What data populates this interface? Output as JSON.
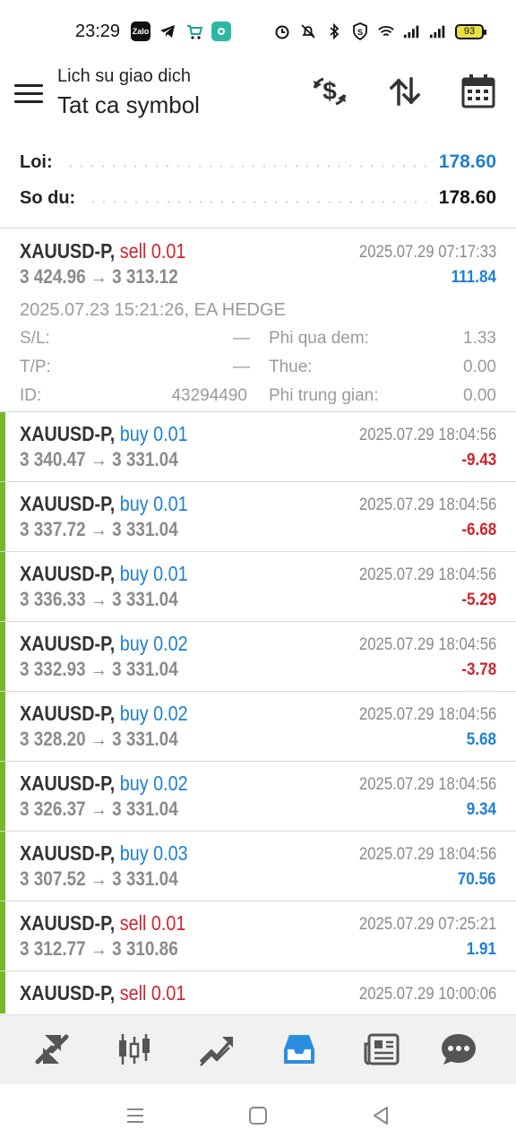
{
  "status_bar": {
    "time": "23:29",
    "battery": "93",
    "app_icons": [
      "zalo-icon",
      "telegram-icon",
      "shopping-icon",
      "maps-icon"
    ],
    "system_icons": [
      "alarm-icon",
      "mute-icon",
      "bluetooth-icon",
      "shield-icon",
      "wifi-icon",
      "signal-icon",
      "signal-icon"
    ]
  },
  "header": {
    "title": "Lich su giao dich",
    "subtitle": "Tat ca symbol",
    "actions": [
      "currency-exchange-icon",
      "sort-icon",
      "calendar-icon"
    ]
  },
  "summary": {
    "profit_label": "Loi:",
    "profit_value": "178.60",
    "balance_label": "So du:",
    "balance_value": "178.60"
  },
  "colors": {
    "buy": "#1e7fd4",
    "sell": "#d0242d",
    "profit_pos": "#1e7fd4",
    "profit_neg": "#d0242d",
    "accent_bar": "#76b82a",
    "active_nav": "#2a8ee0"
  },
  "trades": [
    {
      "symbol": "XAUUSD-P,",
      "type": "sell 0.01",
      "side": "sell",
      "date": "2025.07.29 07:17:33",
      "prices": "3 424.96 → 3 313.12",
      "profit": "111.84",
      "expanded": true,
      "details": {
        "comment": "2025.07.23 15:21:26, EA HEDGE",
        "sl_label": "S/L:",
        "sl_value": "—",
        "tp_label": "T/P:",
        "tp_value": "—",
        "id_label": "ID:",
        "id_value": "43294490",
        "swap_label": "Phi qua dem:",
        "swap_value": "1.33",
        "tax_label": "Thue:",
        "tax_value": "0.00",
        "fee_label": "Phi trung gian:",
        "fee_value": "0.00"
      }
    },
    {
      "symbol": "XAUUSD-P,",
      "type": "buy 0.01",
      "side": "buy",
      "date": "2025.07.29 18:04:56",
      "prices": "3 340.47 → 3 331.04",
      "profit": "-9.43"
    },
    {
      "symbol": "XAUUSD-P,",
      "type": "buy 0.01",
      "side": "buy",
      "date": "2025.07.29 18:04:56",
      "prices": "3 337.72 → 3 331.04",
      "profit": "-6.68"
    },
    {
      "symbol": "XAUUSD-P,",
      "type": "buy 0.01",
      "side": "buy",
      "date": "2025.07.29 18:04:56",
      "prices": "3 336.33 → 3 331.04",
      "profit": "-5.29"
    },
    {
      "symbol": "XAUUSD-P,",
      "type": "buy 0.02",
      "side": "buy",
      "date": "2025.07.29 18:04:56",
      "prices": "3 332.93 → 3 331.04",
      "profit": "-3.78"
    },
    {
      "symbol": "XAUUSD-P,",
      "type": "buy 0.02",
      "side": "buy",
      "date": "2025.07.29 18:04:56",
      "prices": "3 328.20 → 3 331.04",
      "profit": "5.68"
    },
    {
      "symbol": "XAUUSD-P,",
      "type": "buy 0.02",
      "side": "buy",
      "date": "2025.07.29 18:04:56",
      "prices": "3 326.37 → 3 331.04",
      "profit": "9.34"
    },
    {
      "symbol": "XAUUSD-P,",
      "type": "buy 0.03",
      "side": "buy",
      "date": "2025.07.29 18:04:56",
      "prices": "3 307.52 → 3 331.04",
      "profit": "70.56"
    },
    {
      "symbol": "XAUUSD-P,",
      "type": "sell 0.01",
      "side": "sell",
      "date": "2025.07.29 07:25:21",
      "prices": "3 312.77 → 3 310.86",
      "profit": "1.91"
    },
    {
      "symbol": "XAUUSD-P,",
      "type": "sell 0.01",
      "side": "sell",
      "date": "2025.07.29 10:00:06",
      "prices": "",
      "profit": ""
    }
  ],
  "bottom_nav": {
    "items": [
      "quotes-icon",
      "chart-icon",
      "trade-icon",
      "history-icon",
      "news-icon",
      "messages-icon"
    ],
    "active": "history-icon"
  },
  "system_nav": [
    "recents-icon",
    "home-icon",
    "back-icon"
  ]
}
